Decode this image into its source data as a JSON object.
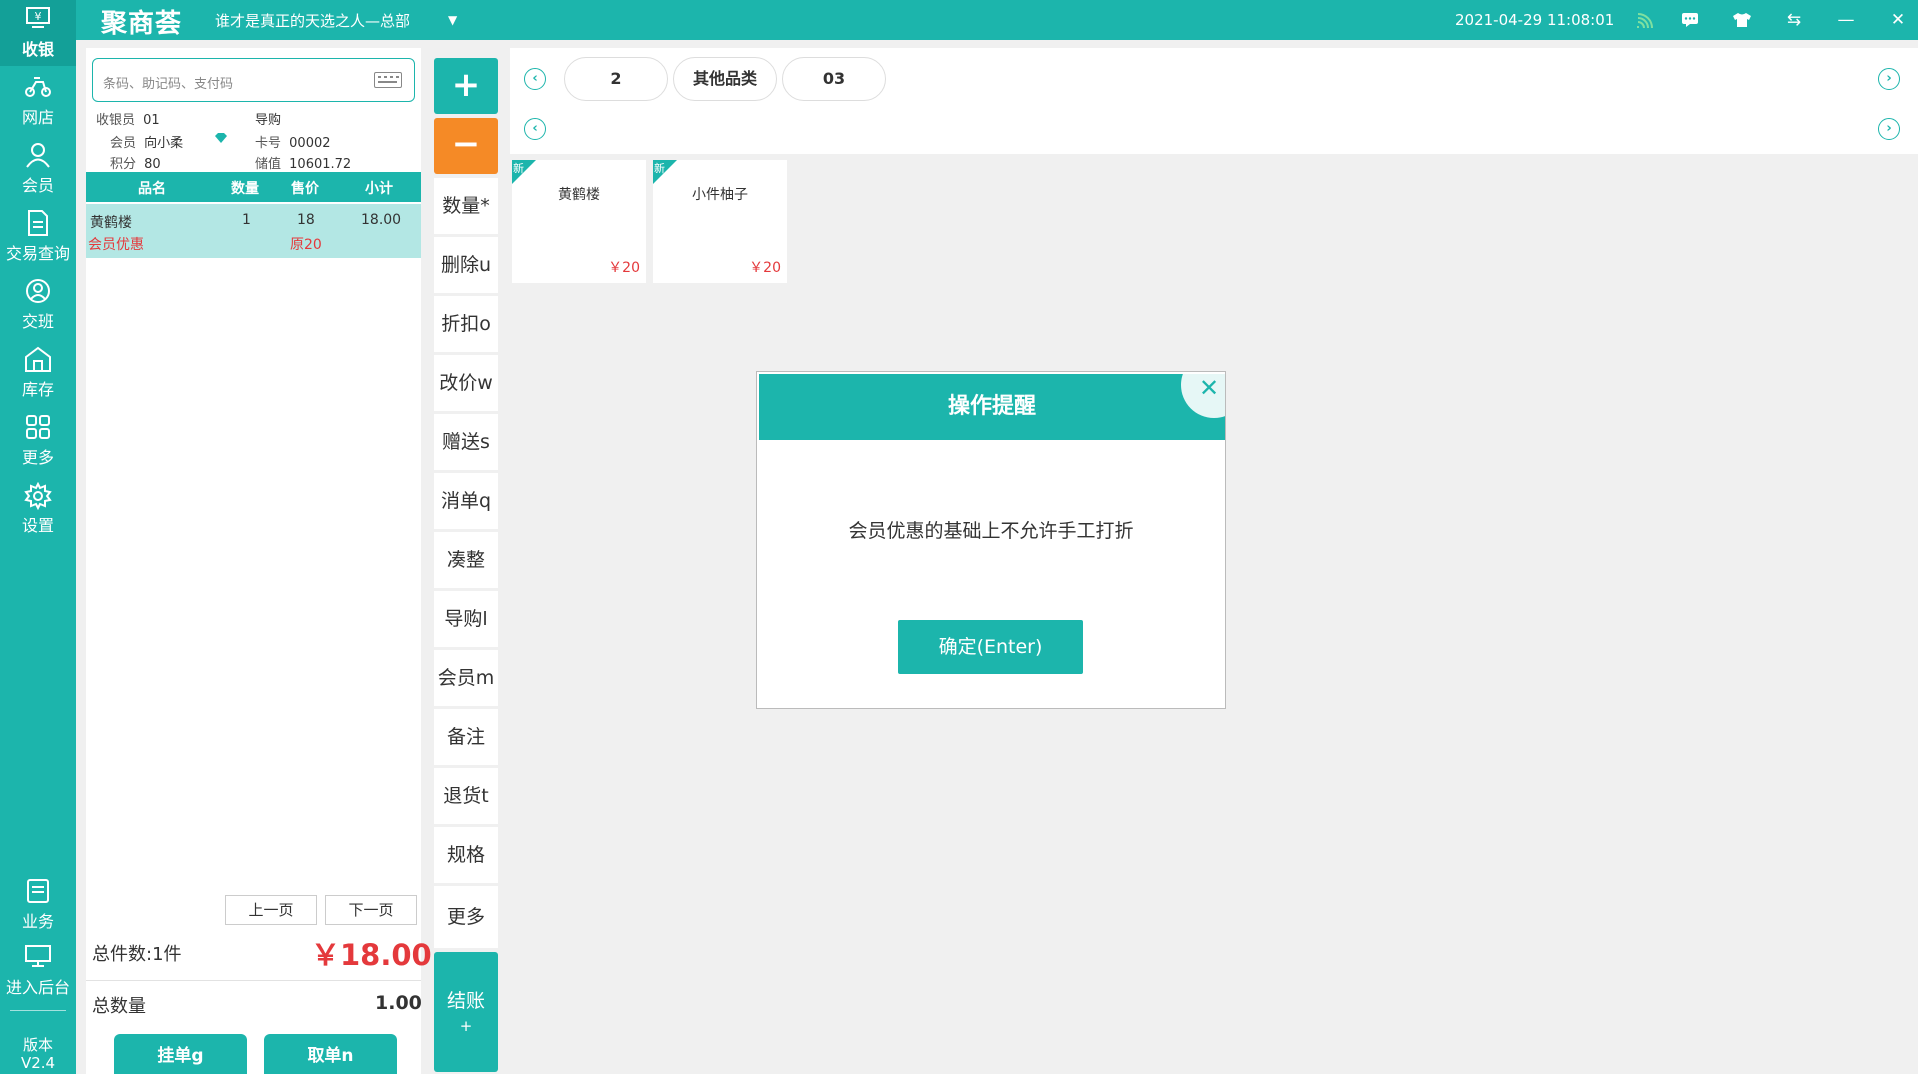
{
  "topbar": {
    "logo": "聚商荟",
    "store": "谁才是真正的天选之人—总部",
    "datetime": "2021-04-29 11:08:01"
  },
  "nav": {
    "items": [
      {
        "label": "收银",
        "icon": "cash-register-icon"
      },
      {
        "label": "网店",
        "icon": "delivery-bike-icon"
      },
      {
        "label": "会员",
        "icon": "user-icon"
      },
      {
        "label": "交易查询",
        "icon": "document-icon"
      },
      {
        "label": "交班",
        "icon": "shift-icon"
      },
      {
        "label": "库存",
        "icon": "warehouse-icon"
      },
      {
        "label": "更多",
        "icon": "grid-icon"
      },
      {
        "label": "设置",
        "icon": "gear-icon"
      },
      {
        "label": "业务",
        "icon": "clipboard-icon"
      },
      {
        "label": "进入后台",
        "icon": "monitor-icon"
      }
    ],
    "version_label": "版本",
    "version": "V2.4"
  },
  "order": {
    "search_placeholder": "条码、助记码、支付码",
    "cashier_label": "收银员",
    "cashier": "01",
    "guide_label": "导购",
    "member_label": "会员",
    "member": "向小柔",
    "card_label": "卡号",
    "card": "00002",
    "points_label": "积分",
    "points": "80",
    "stored_label": "储值",
    "stored": "10601.72",
    "columns": [
      "品名",
      "数量",
      "售价",
      "小计"
    ],
    "items": [
      {
        "name": "黄鹤楼",
        "qty": "1",
        "price": "18",
        "subtotal": "18.00",
        "promo": "会员优惠",
        "original": "原20"
      }
    ],
    "prev_page": "上一页",
    "next_page": "下一页",
    "total_count": "总件数:1件",
    "total_amount": "￥18.00",
    "total_qty_label": "总数量",
    "total_qty": "1.00",
    "hold_button": "挂单g",
    "retrieve_button": "取单n"
  },
  "actions": {
    "plus": "+",
    "minus": "−",
    "buttons": [
      "数量*",
      "删除u",
      "折扣o",
      "改价w",
      "赠送s",
      "消单q",
      "凑整",
      "导购l",
      "会员m",
      "备注",
      "退货t",
      "规格",
      "更多"
    ],
    "checkout": "结账",
    "checkout_sub": "+"
  },
  "categories": [
    "2",
    "其他品类",
    "03"
  ],
  "products": [
    {
      "name": "黄鹤楼",
      "price": "￥20",
      "badge": "新"
    },
    {
      "name": "小件柚子",
      "price": "￥20",
      "badge": "新"
    }
  ],
  "modal": {
    "title": "操作提醒",
    "message": "会员优惠的基础上不允许手工打折",
    "confirm": "确定(Enter)"
  },
  "colors": {
    "accent": "#1cb5ac",
    "orange": "#f58a26",
    "price_red": "#e4393c"
  }
}
